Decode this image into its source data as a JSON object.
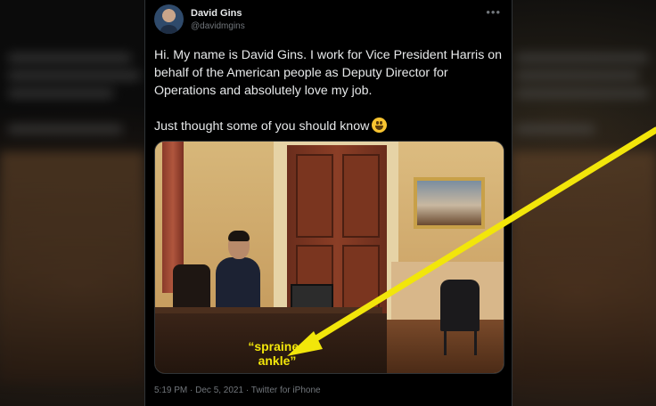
{
  "tweet": {
    "author_name": "David Gins",
    "author_handle": "@davidmgins",
    "more_icon": "•••",
    "text_paragraph_1": "Hi. My name is David Gins. I work for Vice President Harris on behalf of the American people as Deputy Director for Operations and absolutely love my job.",
    "text_paragraph_2": "Just thought some of you should know",
    "emoji": "grinning-face",
    "meta": "5:19 PM · Dec 5, 2021 · Twitter for iPhone"
  },
  "annotation": {
    "caption": "“sprained ankle”",
    "arrow_color": "#f2e60a"
  },
  "colors": {
    "background": "#000000",
    "text_primary": "#e7e9ea",
    "text_secondary": "#71767b",
    "border": "#2f3336"
  }
}
